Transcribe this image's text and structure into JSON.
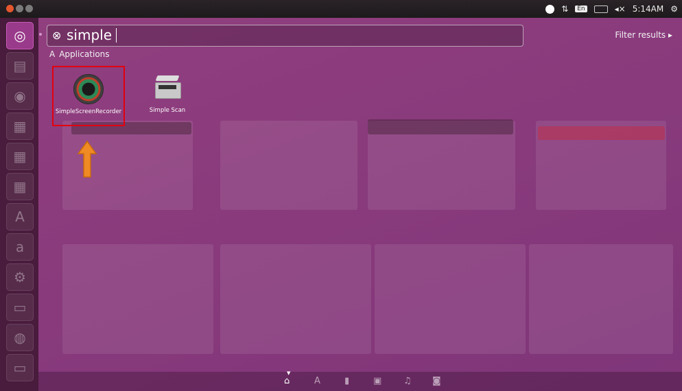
{
  "panel": {
    "time": "5:14AM",
    "keyboard": "En"
  },
  "search": {
    "query": "simple"
  },
  "filter_label": "Filter results ▸",
  "category": "Applications",
  "apps": [
    {
      "label": "SimpleScreenRecorder"
    },
    {
      "label": "Simple Scan"
    }
  ],
  "icons": {
    "launcher": [
      "ubuntu-home-icon",
      "files-icon",
      "browser-icon",
      "writer-icon",
      "calc-icon",
      "impress-icon",
      "software-center-icon",
      "amazon-icon",
      "settings-icon",
      "terminal-icon",
      "disc-icon",
      "workspace-icon",
      "trash-icon"
    ],
    "lenses": [
      "home-lens-icon",
      "applications-lens-icon",
      "files-lens-icon",
      "video-lens-icon",
      "music-lens-icon",
      "photos-lens-icon"
    ]
  },
  "colors": {
    "highlight_box": "#e3000f",
    "arrow": "#f08a24"
  }
}
